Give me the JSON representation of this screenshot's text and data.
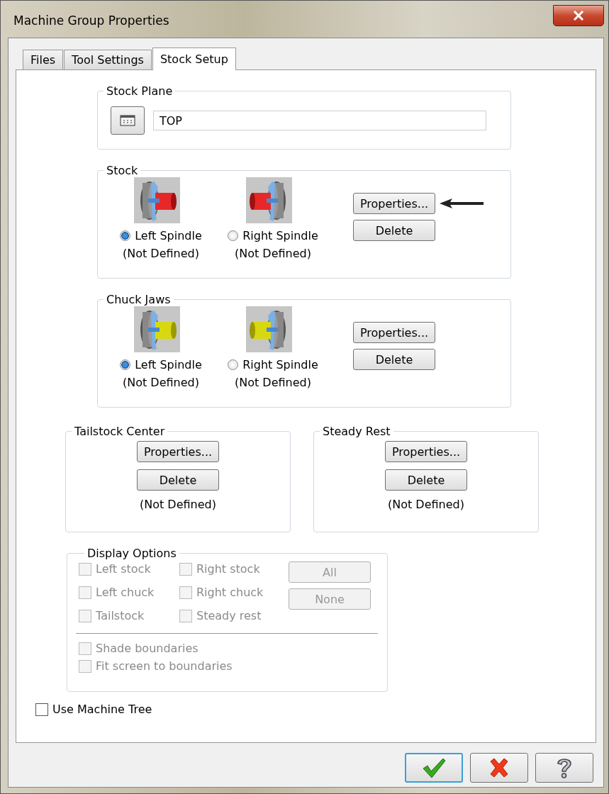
{
  "window": {
    "title": "Machine Group Properties"
  },
  "tabs": [
    {
      "label": "Files",
      "selected": false
    },
    {
      "label": "Tool Settings",
      "selected": false
    },
    {
      "label": "Stock Setup",
      "selected": true
    }
  ],
  "stock_plane": {
    "title": "Stock Plane",
    "value": "TOP"
  },
  "spindle_groups": [
    {
      "title": "Stock",
      "kind": "stock",
      "options": [
        {
          "label": "Left Spindle",
          "status": "(Not Defined)",
          "selected": true
        },
        {
          "label": "Right Spindle",
          "status": "(Not Defined)",
          "selected": false
        }
      ],
      "buttons": [
        "Properties...",
        "Delete"
      ],
      "pointer": true
    },
    {
      "title": "Chuck Jaws",
      "kind": "jaws",
      "options": [
        {
          "label": "Left Spindle",
          "status": "(Not Defined)",
          "selected": true
        },
        {
          "label": "Right Spindle",
          "status": "(Not Defined)",
          "selected": false
        }
      ],
      "buttons": [
        "Properties...",
        "Delete"
      ],
      "pointer": false
    }
  ],
  "side_groups": [
    {
      "title": "Tailstock Center",
      "buttons": [
        "Properties...",
        "Delete"
      ],
      "status": "(Not Defined)"
    },
    {
      "title": "Steady Rest",
      "buttons": [
        "Properties...",
        "Delete"
      ],
      "status": "(Not Defined)"
    }
  ],
  "display_options": {
    "title": "Display Options",
    "columns": [
      [
        {
          "label": "Left stock",
          "checked": false,
          "disabled": true
        },
        {
          "label": "Left chuck",
          "checked": false,
          "disabled": true
        },
        {
          "label": "Tailstock",
          "checked": false,
          "disabled": true
        }
      ],
      [
        {
          "label": "Right stock",
          "checked": false,
          "disabled": true
        },
        {
          "label": "Right chuck",
          "checked": false,
          "disabled": true
        },
        {
          "label": "Steady rest",
          "checked": false,
          "disabled": true
        }
      ]
    ],
    "buttons": [
      {
        "label": "All",
        "disabled": true
      },
      {
        "label": "None",
        "disabled": true
      }
    ],
    "extra": [
      {
        "label": "Shade boundaries",
        "checked": false,
        "disabled": true
      },
      {
        "label": "Fit screen to boundaries",
        "checked": false,
        "disabled": true
      }
    ]
  },
  "use_machine_tree": {
    "label": "Use Machine Tree",
    "checked": false
  },
  "footer_buttons": [
    {
      "kind": "ok",
      "focused": true
    },
    {
      "kind": "cancel",
      "focused": false
    },
    {
      "kind": "help",
      "focused": false
    }
  ]
}
